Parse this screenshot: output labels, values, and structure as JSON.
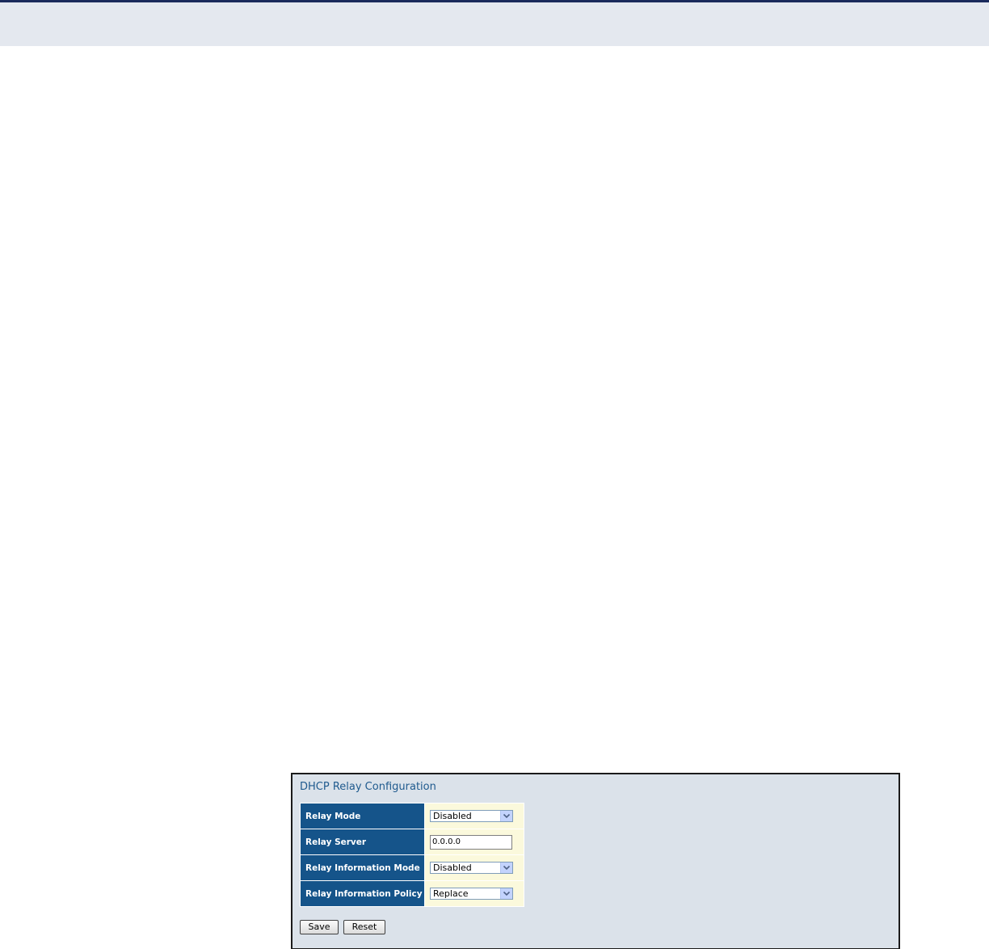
{
  "page": {
    "header_band_color": "#e4e8ef",
    "header_rule_color": "#1a2a5c"
  },
  "panel": {
    "title": "DHCP Relay Configuration",
    "label_bg_color": "#15548a",
    "value_bg_color": "#fbf9dc",
    "panel_bg_color": "#dbe2ea",
    "rows": [
      {
        "label": "Relay Mode",
        "control": "select",
        "value": "Disabled",
        "icon": "chevron-down-icon"
      },
      {
        "label": "Relay Server",
        "control": "text-input",
        "value": "0.0.0.0"
      },
      {
        "label": "Relay Information Mode",
        "control": "select",
        "value": "Disabled",
        "icon": "chevron-down-icon"
      },
      {
        "label": "Relay Information Policy",
        "control": "select",
        "value": "Replace",
        "icon": "chevron-down-icon"
      }
    ],
    "buttons": {
      "save_label": "Save",
      "reset_label": "Reset"
    }
  }
}
